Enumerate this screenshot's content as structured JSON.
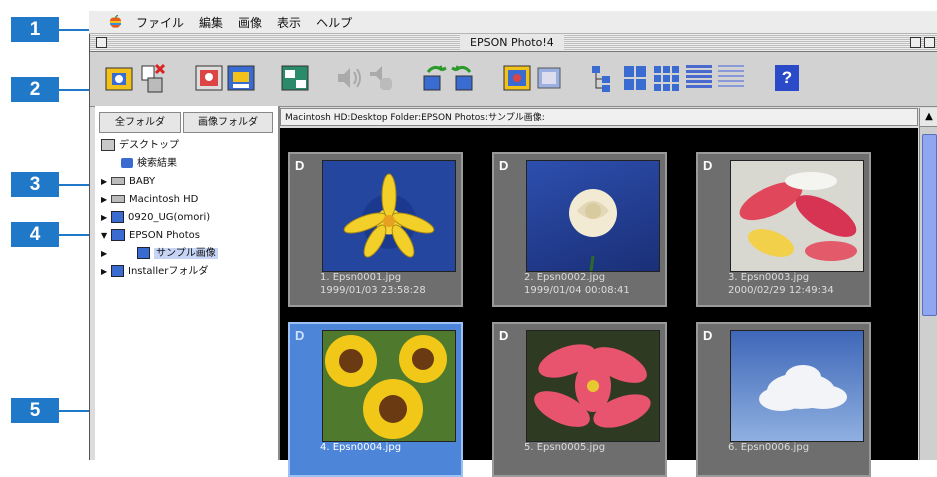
{
  "callouts": [
    "1",
    "2",
    "3",
    "4",
    "5"
  ],
  "menubar": {
    "apple_icon": "apple-icon",
    "items": [
      "ファイル",
      "編集",
      "画像",
      "表示",
      "ヘルプ"
    ]
  },
  "window": {
    "title": "EPSON Photo!4"
  },
  "folder_tabs": [
    "全フォルダ",
    "画像フォルダ"
  ],
  "tree": [
    {
      "label": "デスクトップ",
      "icon": "desktop-icon",
      "arrow": ""
    },
    {
      "label": "検索結果",
      "icon": "search-results-icon",
      "arrow": ""
    },
    {
      "label": "BABY",
      "icon": "disk-icon",
      "arrow": "▶"
    },
    {
      "label": "Macintosh HD",
      "icon": "disk-icon",
      "arrow": "▶"
    },
    {
      "label": "0920_UG(omori)",
      "icon": "folder-icon",
      "arrow": "▶"
    },
    {
      "label": "EPSON Photos",
      "icon": "folder-icon",
      "arrow": "▼"
    },
    {
      "label": "サンプル画像",
      "icon": "folder-icon",
      "arrow": "▶"
    },
    {
      "label": "Installerフォルダ",
      "icon": "folder-icon",
      "arrow": "▶"
    }
  ],
  "path": "Macintosh HD:Desktop Folder:EPSON Photos:サンプル画像:",
  "thumbnails": [
    {
      "badge": "D",
      "name": "1. Epsn0001.jpg",
      "date": "1999/01/03  23:58:28",
      "photo": "yellow-lily-photo"
    },
    {
      "badge": "D",
      "name": "2. Epsn0002.jpg",
      "date": "1999/01/04  00:08:41",
      "photo": "white-rose-photo"
    },
    {
      "badge": "D",
      "name": "3. Epsn0003.jpg",
      "date": "2000/02/29  12:49:34",
      "photo": "red-petals-photo"
    },
    {
      "badge": "D",
      "name": "4. Epsn0004.jpg",
      "date": "",
      "photo": "sunflowers-photo"
    },
    {
      "badge": "D",
      "name": "5. Epsn0005.jpg",
      "date": "",
      "photo": "poinsettia-photo"
    },
    {
      "badge": "D",
      "name": "6. Epsn0006.jpg",
      "date": "",
      "photo": "clouds-photo"
    }
  ],
  "toolbar_icons": [
    "camera-icon",
    "delete-icon",
    "photo-frame-icon",
    "print-icon",
    "image-info-icon",
    "sound-icon",
    "sound-off-icon",
    "rotate-left-icon",
    "rotate-right-icon",
    "slideshow-icon",
    "film-icon",
    "tree-view-icon",
    "large-thumb-icon",
    "medium-thumb-icon",
    "small-thumb-icon",
    "list-view-icon",
    "help-icon"
  ],
  "help_label": "?",
  "colors": {
    "callout": "#1f78c8",
    "selection": "#4d86d8",
    "grid_bg": "#000000"
  }
}
